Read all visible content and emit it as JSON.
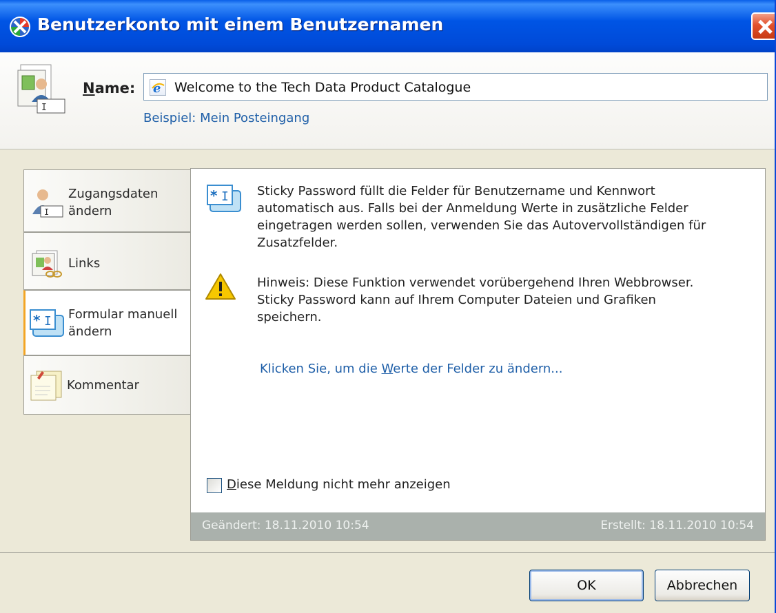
{
  "window": {
    "title": "Benutzerkonto mit einem Benutzernamen"
  },
  "header": {
    "name_label": "Name:",
    "name_value": "Welcome to the Tech Data Product Catalogue",
    "example": "Beispiel: Mein Posteingang"
  },
  "tabs": [
    {
      "line1": "Zugangsdaten",
      "line2": "ändern",
      "icon": "user-card-icon"
    },
    {
      "line1": "Links",
      "line2": "",
      "icon": "links-icon"
    },
    {
      "line1": "Formular manuell",
      "line2": "ändern",
      "icon": "form-field-icon"
    },
    {
      "line1": "Kommentar",
      "line2": "",
      "icon": "note-icon"
    }
  ],
  "content": {
    "info_lines": [
      "Sticky Password füllt die Felder für Benutzername und Kennwort",
      "automatisch aus. Falls bei der Anmeldung Werte in zusätzliche Felder",
      "eingetragen werden sollen, verwenden Sie das Autovervollständigen für",
      "Zusatzfelder."
    ],
    "warning_lines": [
      "Hinweis: Diese Funktion verwendet vorübergehend Ihren Webbrowser.",
      "Sticky Password kann auf Ihrem Computer Dateien und Grafiken",
      "speichern."
    ],
    "link_before": "Klicken Sie, um die ",
    "link_accel": "W",
    "link_after": "erte der Felder zu ändern...",
    "checkbox_accel": "D",
    "checkbox_rest": "iese Meldung nicht mehr anzeigen",
    "checkbox_checked": false,
    "modified": "Geändert: 18.11.2010 10:54",
    "created": "Erstellt: 18.11.2010 10:54"
  },
  "buttons": {
    "ok": "OK",
    "cancel": "Abbrechen"
  }
}
